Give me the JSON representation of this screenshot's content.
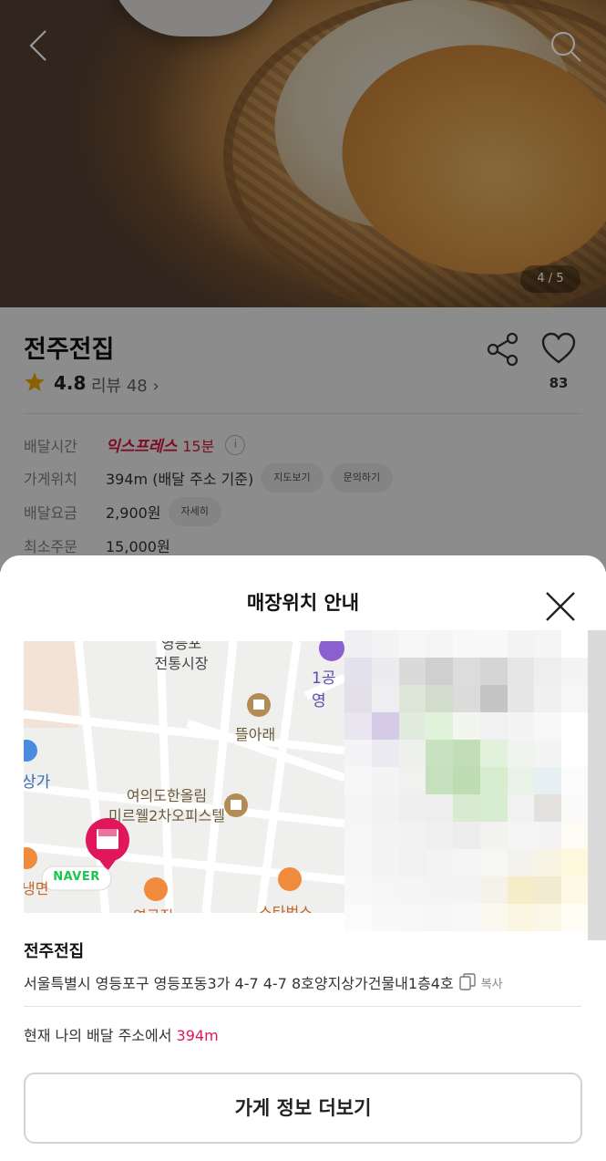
{
  "hero": {
    "image_counter": "4 / 5",
    "back_icon": "chevron-left-icon",
    "search_icon": "search-icon"
  },
  "store": {
    "name": "전주전집",
    "rating": "4.8",
    "review_label": "리뷰 48",
    "likes": "83",
    "rows": {
      "delivery_time_label": "배달시간",
      "express_label": "익스프레스",
      "delivery_minutes": "15분",
      "location_label": "가게위치",
      "location_value": "394m (배달 주소 기준)",
      "map_chip": "지도보기",
      "inquiry_chip": "문의하기",
      "fee_label": "배달요금",
      "fee_value": "2,900원",
      "fee_detail_chip": "자세히",
      "min_order_label": "최소주문",
      "min_order_value": "15,000원"
    },
    "accent_color": "#e0173f"
  },
  "sheet": {
    "title": "매장위치 안내",
    "map_labels": {
      "market": "영등포\n전통시장",
      "parking": "1공영",
      "place1": "뜰아래",
      "place2": "여의도한올림\n미르웰2차오피스텔",
      "left_label": "상가",
      "left_label2": "냉면",
      "bottom1": "연곡집",
      "bottom2": "스타벅스",
      "naver": "NAVER"
    },
    "store_name": "전주전집",
    "address": "서울특별시 영등포구 영등포동3가 4-7 4-7 8호양지상가건물내1층4호",
    "copy_label": "복사",
    "distance_prefix": "현재 나의 배달 주소에서 ",
    "distance_value": "394m",
    "more_button": "가게 정보 더보기",
    "highlight_color": "#e0175b"
  }
}
